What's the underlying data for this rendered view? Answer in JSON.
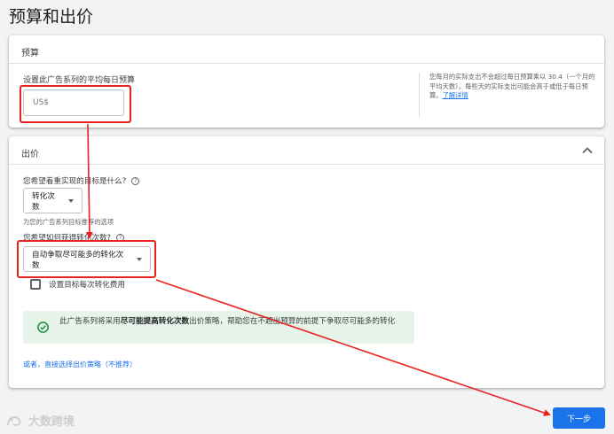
{
  "page": {
    "title": "预算和出价"
  },
  "budget": {
    "header": "预算",
    "label": "设置此广告系列的平均每日预算",
    "input_placeholder": "US$",
    "note_text": "您每月的实际支出不会超过每日预算乘以 30.4（一个月的平均天数）。每些天的实际支出可能会高于或低于每日预算。",
    "note_link": "了解详情"
  },
  "bidding": {
    "header": "出价",
    "goal_question": "您希望着重实现的目标是什么?",
    "goal_select": "转化次数",
    "goal_hint": "为您的广告系列目标推荐的选项",
    "method_question": "您希望如何获得转化次数?",
    "method_select": "自动争取尽可能多的转化次数",
    "checkbox_label": "设置目标每次转化费用",
    "banner_pre": "此广告系列将采用",
    "banner_strong": "尽可能提高转化次数",
    "banner_post": "出价策略，帮助您在不超出预算的前提下争取尽可能多的转化",
    "alt_link": "或者，直接选择出价策略（不推荐）"
  },
  "footer": {
    "watermark": "大数跨境",
    "next_button": "下一步"
  },
  "colors": {
    "accent": "#1a73e8",
    "annotation": "#e8221f",
    "success_bg": "#e6f4ea",
    "success_icon": "#1e8e3e"
  }
}
